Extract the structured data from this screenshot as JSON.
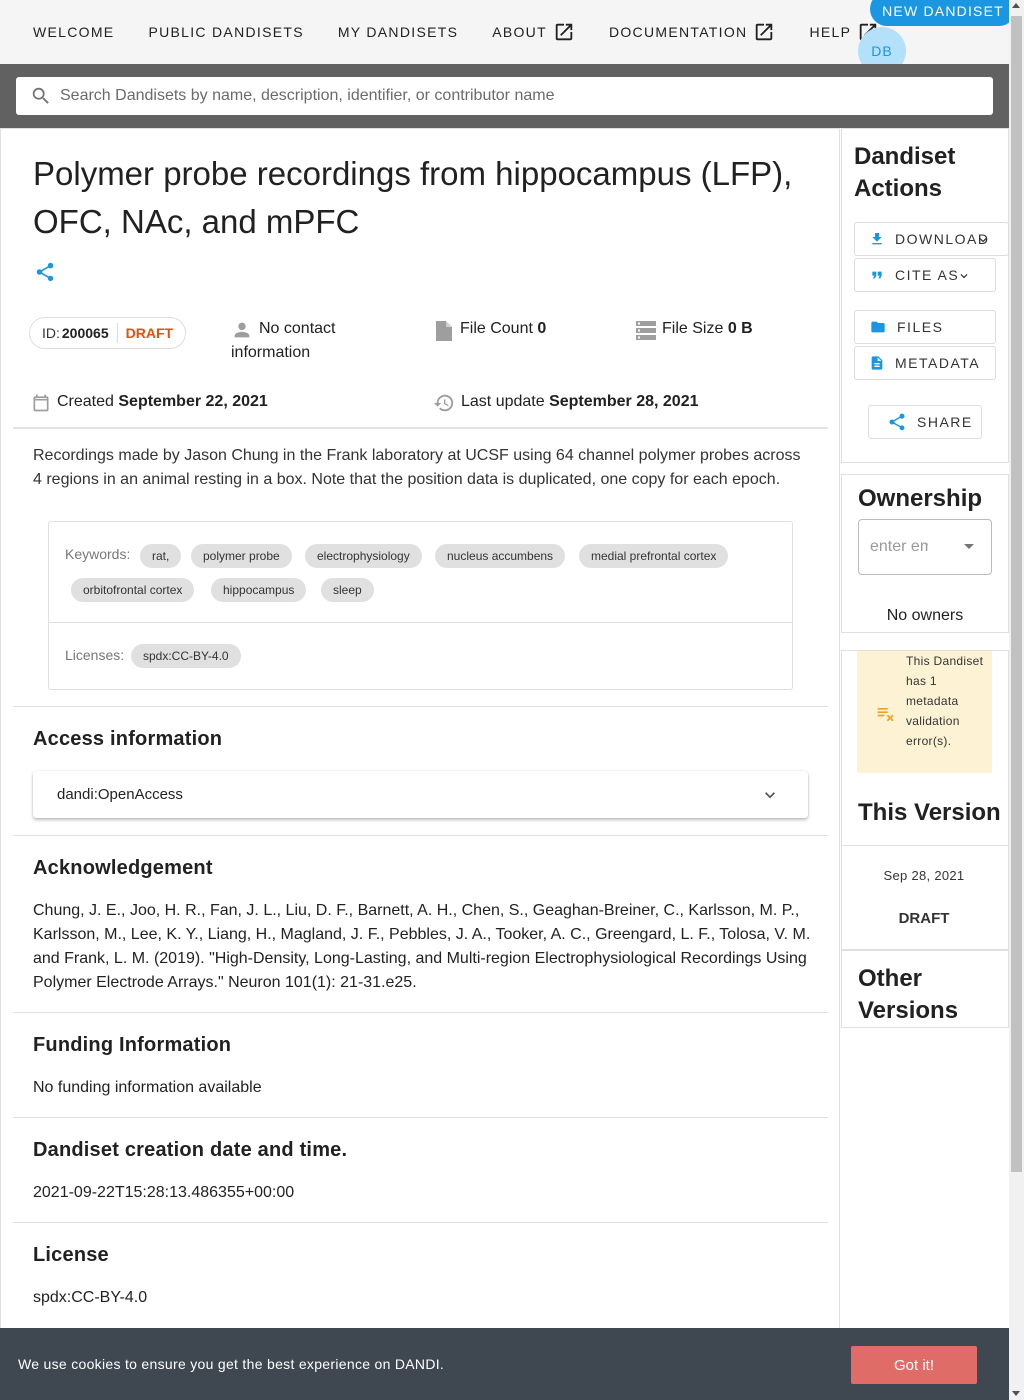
{
  "nav": {
    "items": [
      {
        "label": "WELCOME"
      },
      {
        "label": "PUBLIC DANDISETS"
      },
      {
        "label": "MY DANDISETS"
      },
      {
        "label": "ABOUT"
      },
      {
        "label": "DOCUMENTATION"
      },
      {
        "label": "HELP"
      }
    ],
    "new_dandiset_label": "NEW DANDISET",
    "avatar_initials": "DB"
  },
  "search": {
    "placeholder": "Search Dandisets by name, description, identifier, or contributor name"
  },
  "dandiset": {
    "title": "Polymer probe recordings from hippocampus (LFP), OFC, NAc, and mPFC",
    "id_label": "ID:",
    "id": "200065",
    "status": "DRAFT",
    "contact": "No contact information",
    "file_count_label": "File Count",
    "file_count": "0",
    "file_size_label": "File Size",
    "file_size": "0 B",
    "created_label": "Created",
    "created": "September 22, 2021",
    "updated_label": "Last update",
    "updated": "September 28, 2021",
    "description": "Recordings made by Jason Chung in the Frank laboratory at UCSF using 64 channel polymer probes across 4 regions in an animal resting in a box. Note that the position data is duplicated, one copy for each epoch.",
    "keywords_label": "Keywords:",
    "keywords": [
      "rat,",
      "polymer probe",
      "electrophysiology",
      "nucleus accumbens",
      "medial prefrontal cortex",
      "orbitofrontal cortex",
      "hippocampus",
      "sleep"
    ],
    "licenses_label": "Licenses:",
    "licenses": [
      "spdx:CC-BY-4.0"
    ]
  },
  "sections": {
    "access_title": "Access information",
    "access_value": "dandi:OpenAccess",
    "ack_title": "Acknowledgement",
    "ack_text": "Chung, J. E., Joo, H. R., Fan, J. L., Liu, D. F., Barnett, A. H., Chen, S., Geaghan-Breiner, C., Karlsson, M. P., Karlsson, M., Lee, K. Y., Liang, H., Magland, J. F., Pebbles, J. A., Tooker, A. C., Greengard, L. F., Tolosa, V. M. and Frank, L. M. (2019). \"High-Density, Long-Lasting, and Multi-region Electrophysiological Recordings Using Polymer Electrode Arrays.\" Neuron 101(1): 21-31.e25.",
    "funding_title": "Funding Information",
    "funding_text": "No funding information available",
    "creation_title": "Dandiset creation date and time.",
    "creation_text": "2021-09-22T15:28:13.486355+00:00",
    "license_title": "License",
    "license_text": "spdx:CC-BY-4.0"
  },
  "sidebar": {
    "actions_title": "Dandiset Actions",
    "download_label": "DOWNLOAD",
    "cite_label": "CITE AS",
    "files_label": "FILES",
    "metadata_label": "METADATA",
    "share_label": "SHARE",
    "ownership_title": "Ownership",
    "owner_placeholder": "enter email",
    "no_owners": "No owners",
    "validation_text": "This Dandiset has 1 metadata validation error(s).",
    "this_version_title": "This Version",
    "version_date": "Sep 28, 2021",
    "version_label": "DRAFT",
    "other_versions_title": "Other Versions"
  },
  "cookie": {
    "text": "We use cookies to ensure you get the best experience on DANDI.",
    "button": "Got it!"
  },
  "colors": {
    "accent": "#1a97e0",
    "draft": "#e65100",
    "warning_bg": "#fdf3d4",
    "warning_icon": "#f0a020",
    "cookie_bg": "#3f4750",
    "cookie_button": "#e06c68"
  }
}
